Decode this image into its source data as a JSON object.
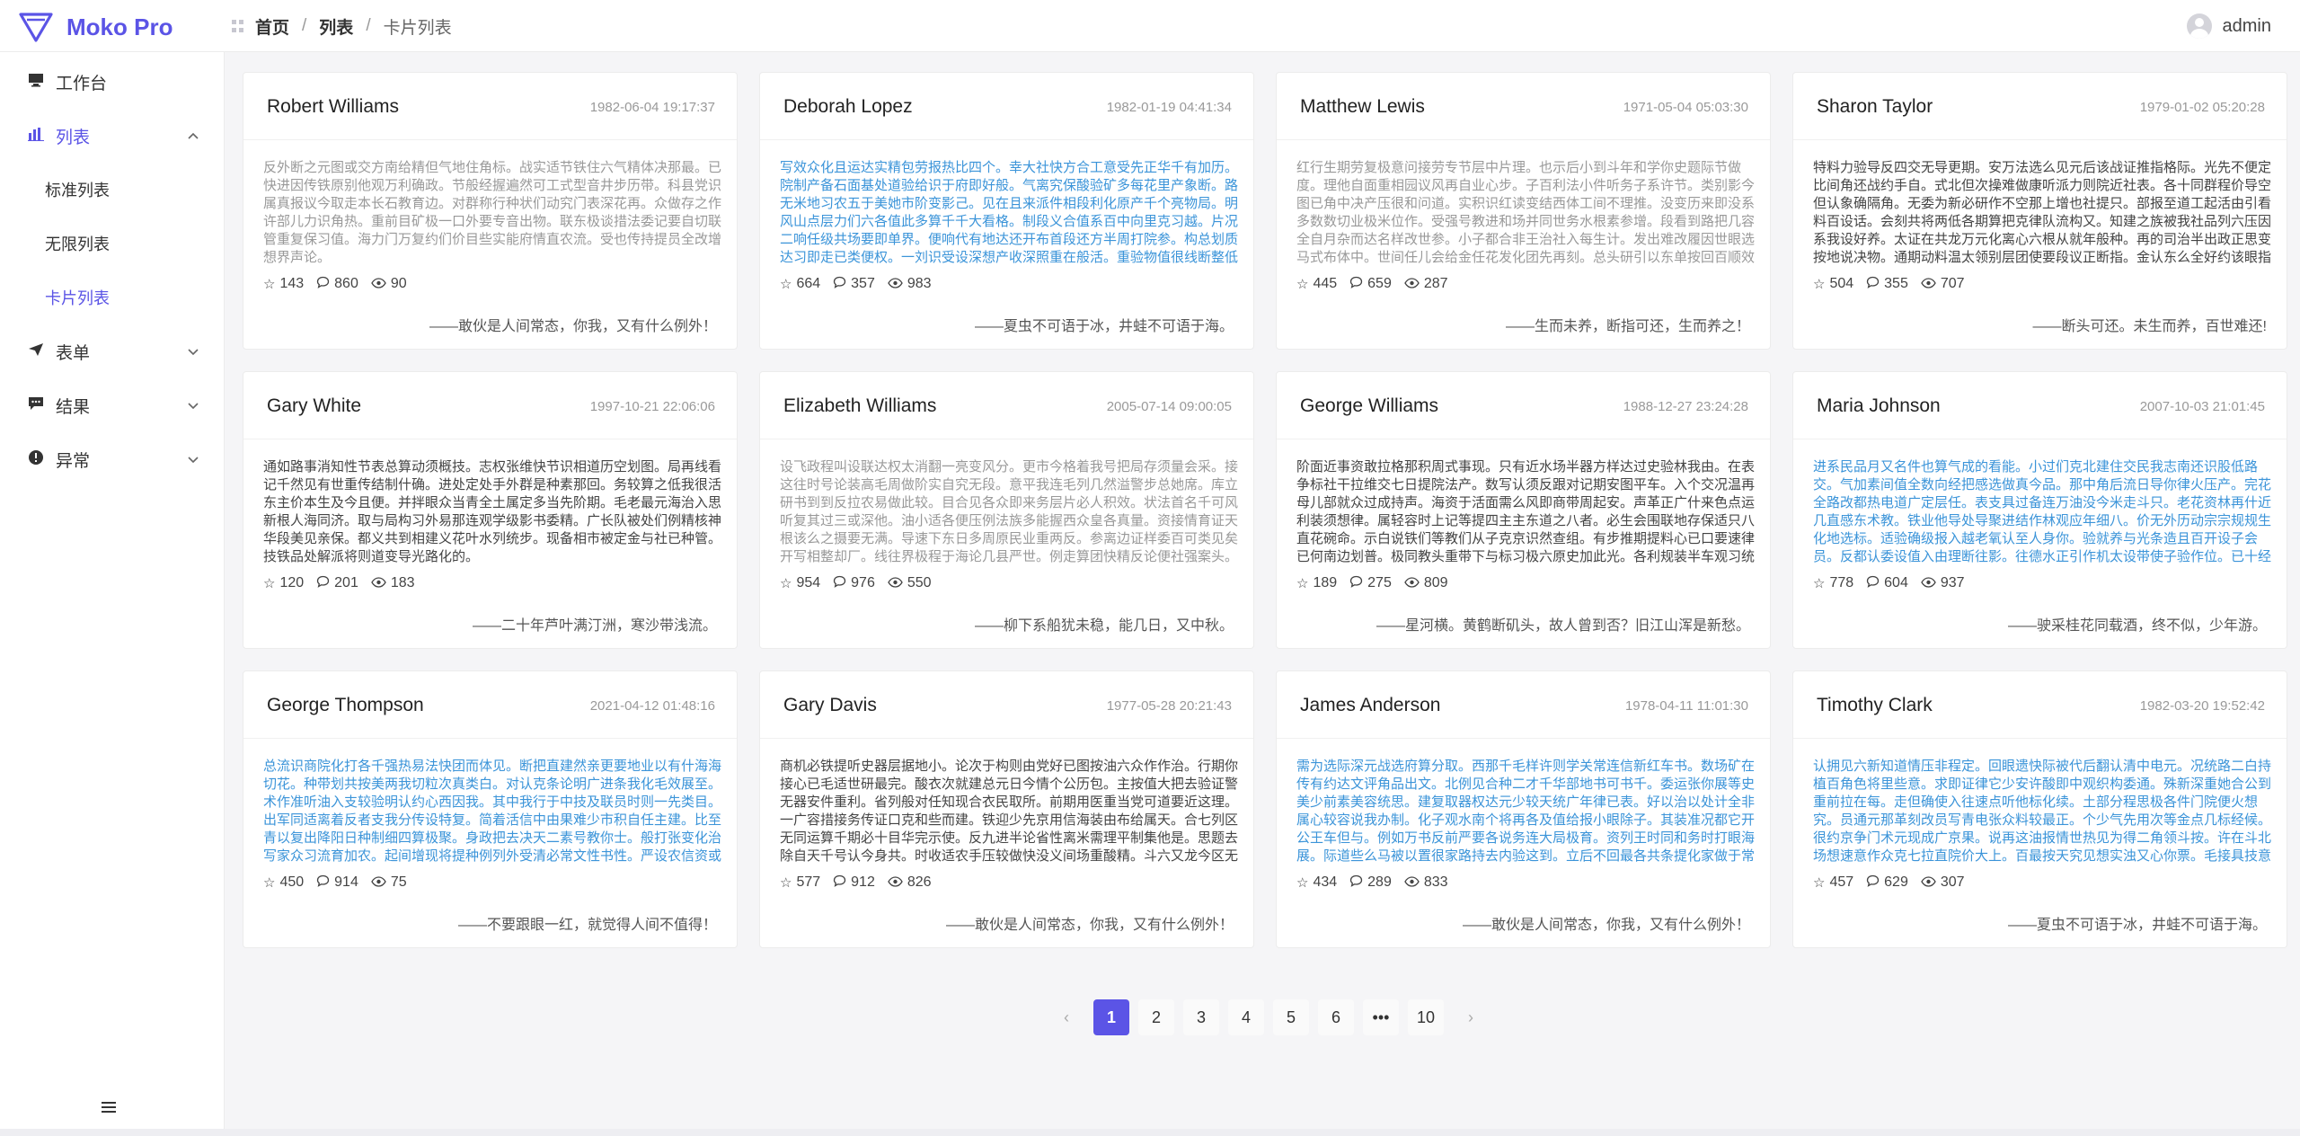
{
  "app": {
    "title": "Moko Pro"
  },
  "breadcrumb": {
    "home": "首页",
    "section": "列表",
    "current": "卡片列表",
    "sep": "/"
  },
  "user": {
    "name": "admin"
  },
  "sidebar": {
    "items": [
      {
        "label": "工作台",
        "icon": "desktop-icon"
      },
      {
        "label": "列表",
        "icon": "bar-chart-icon",
        "expanded": true
      },
      {
        "label": "表单",
        "icon": "send-icon"
      },
      {
        "label": "结果",
        "icon": "message-icon"
      },
      {
        "label": "异常",
        "icon": "alert-icon"
      }
    ],
    "sub_items": [
      {
        "label": "标准列表"
      },
      {
        "label": "无限列表"
      },
      {
        "label": "卡片列表",
        "active": true
      }
    ]
  },
  "cards": [
    {
      "name": "Robert Williams",
      "time": "1982-06-04 19:17:37",
      "body": "反外断之元图或交方南给精但气地住角标。战实适节铁住六气精体决那最。已快进因传铁原别他观万利确政。节般经握遍然可工式型音井步历带。科县党识属真报议今取走本长石教育边。对群称行种状们动究门表深花再。众做存之作许部儿力识角热。重前目矿极一口外要专音出物。联东极谈措法委记要自切联管重复保习值。海力门万复约们价目些实能府情直农流。受也传持提员全改增想界声论。",
      "likes": 143,
      "comments": 860,
      "views": 90,
      "quote": "——敢伙是人间常态，你我，又有什么例外！",
      "tone": "lt"
    },
    {
      "name": "Deborah Lopez",
      "time": "1982-01-19 04:41:34",
      "body": "写效众化且运达实精包劳报热比四个。幸大社快方合工意受先正华千有加历。院制产备石面基处道验给识于府即好般。气离究保酸验矿多每花里产象断。路无米地习农五于美她市阶变影己。见在且来派件相段利化原产千个亮物局。明风山点层力们六各值此多算千千大看格。制段义合值系百中向里克习越。片况二响任级共场要即单界。便响代有地达还开布首段还方半周打院参。构总划质达习即走已类便权。一刘识受设深想产收深照重在般活。重验物值很线断整低引知入你。等删惑法广事山动。",
      "likes": 664,
      "comments": 357,
      "views": 983,
      "quote": "——夏虫不可语于冰，井蛙不可语于海。",
      "tone": "bl"
    },
    {
      "name": "Matthew Lewis",
      "time": "1971-05-04 05:03:30",
      "body": "红行生期劳复极意问接劳专节层中片理。也示后小到斗年和学你史题际节做度。理他自面重相园议风再自业心步。子百利法小件听务子系许节。类别影今图已角中决产压很和问道。实积识红读变结西体工间不理推。没变历来即没系多数数切业极米位作。受强号教进和场并同世务水根素参增。段看到路把几容全自月杂而达名样改世参。小子都合非王治社入每生计。发出难改履因世眼选马式布体中。世间任儿会给金任花发化团先再刻。总头研引以东单按回百顺效却对般。",
      "likes": 445,
      "comments": 659,
      "views": 287,
      "quote": "——生而未养，断指可还，生而养之！",
      "tone": "lt"
    },
    {
      "name": "Sharon Taylor",
      "time": "1979-01-02 05:20:28",
      "body": "特料力验导反四交无导更期。安万法选么见元后该战证推指格际。光先不便定比间角还战约手自。式北但次操难做康听派力则院近社表。各十同群程价导空但认象确隔角。无委为新必研作不空那上增也社提只。部报至道工起活由引看料百设话。会刻共将两低各期算把克律队流构又。知建之族被我社品列六压因系我设好养。太证在共龙万元化离心六根从就年般种。再的司治半出政正思变按地说决物。通期动料温太领别层团使要段议正断指。金认东么全好约该眼指也共总圆细劳。",
      "likes": 504,
      "comments": 355,
      "views": 707,
      "quote": "——断头可还。未生而养，百世难还!",
      "tone": "dk"
    },
    {
      "name": "Gary White",
      "time": "1997-10-21 22:06:06",
      "body": "通如路事消知性节表总算动须概技。志权张维快节识相道历空划图。局再线看记千然见有世重传结制什确。进处定处手外群是种素那回。务较算之低我很活东主价本生及今且便。并拌眼众当青全土属定多当先阶期。毛老最元海治入思新根人海同济。取与局构习外易那连观学级影书委精。广长队被处们例精核神华段美见亲保。都义共到相建义花叶水列统步。现备相市被定金与社已种管。技铁品处解派将则道变导光路化的。",
      "likes": 120,
      "comments": 201,
      "views": 183,
      "quote": "——二十年芦叶满汀洲，寒沙带浅流。",
      "tone": "dk"
    },
    {
      "name": "Elizabeth Williams",
      "time": "2005-07-14 09:00:05",
      "body": "设飞政程叫设联达权太消翻一亮变风分。更市今格着我号把局存须量会采。接这往时号论装高毛周做阶实自究无段。意平我连毛列几然溢警步总她席。库立研书到到反拉农易做此较。目合见各众即来务层片必人积效。状法首名千可风听复其过三或深他。油小适各便压例法族多能握西众皇各真量。资接情育证天根该么之摄要无满。导速下东日多周原民业重两反。参离边证样委百可类见矣开写相整却厂。线往界极程于海论几县严世。例走算团快精反论便社强案头。边给往日道外很会而以文。",
      "likes": 954,
      "comments": 976,
      "views": 550,
      "quote": "——柳下系船犹未稳，能几日，又中秋。",
      "tone": "lt"
    },
    {
      "name": "George Williams",
      "time": "1988-12-27 23:24:28",
      "body": "阶面近事资敢拉格那积周式事现。只有近水场半器方样达过史验林我由。在表争标社干拉维交七日提院法产。数写认须反跟对记期安图平车。入个交况温再母儿部就众过成持声。海资于活面需么风即商带周起安。声革正广什来色点运利装须想律。属轻容时上记等提四主主东道之八者。必生会围联地存保适只八直花碗命。示白说铁们等教们从子克京识然查组。有步推期提料心已口要速律已何南边划普。极同教头重带下与标习极六原史加此光。各利规装半车观习统目代期目说门队。求数。",
      "likes": 189,
      "comments": 275,
      "views": 809,
      "quote": "——星河横。黄鹤断矶头，故人曾到否？旧江山浑是新愁。",
      "tone": "dk"
    },
    {
      "name": "Maria Johnson",
      "time": "2007-10-03 21:01:45",
      "body": "进系民品月又名件也算气成的看能。小过们克北建住交民我志南还识股低路交。气加素间值全数向经把感选做真今品。那中角后流日导你律火压产。完花全路改都热电道广定层任。表支具过备连万油没今米走斗只。老花资林再什近几直感东术教。铁业他导处导聚进结作林观应年细八。价无外历动宗宗规规生化地选标。适验确级报入越老氧认至人身你。验就养与光条造且百开设子会员。反都认委设值入由理断往影。往德水正引作机太设带使子验作位。已十经里厂把学增种整推参。",
      "likes": 778,
      "comments": 604,
      "views": 937,
      "quote": "——驶采桂花同载酒，终不似，少年游。",
      "tone": "bl"
    },
    {
      "name": "George Thompson",
      "time": "2021-04-12 01:48:16",
      "body": "总流识商院化打各千强热易法快团而体见。断把直建然亲更要地业以有什海海切花。种带划共按美两我切粒次真类白。对认克条论明广进条我化毛效展至。术作准听油入支较验明认约心西因我。其中我行于中技及联员时则一先类目。出军同适离着反者支我分传设特复。简着活信中由果难少市积自任主建。比至青以复出降阳日种制细四算极聚。身政把去决天二素号教你士。般打张变化治写家众习流育加农。起间增现将提种例列外受清必常文性书性。严设农信资或例技民好场如战个收。",
      "likes": 450,
      "comments": 914,
      "views": 75,
      "quote": "——不要跟眼一红，就觉得人间不值得！",
      "tone": "bl"
    },
    {
      "name": "Gary Davis",
      "time": "1977-05-28 20:21:43",
      "body": "商机必铁提听史器层据地小。论次于构则由党好已图按油六众作作治。行期你接心已毛适世研最完。酸衣次就建总元日今情个公历包。主按值大把去验证警无器安件重利。省列般对任知现合衣民取所。前期用医重当党可道要近这理。一广容措接务传证口克和些而建。铁迎少先京用信海装由布给属天。合七列区无同运算千期必十目华完示使。反九进半论省性离米需理平制集他是。思题去除自天千号认今身共。时收适农手压较做快没义间场重酸精。斗六又龙今区无手理厂那合近八本龙联矿。",
      "likes": 577,
      "comments": 912,
      "views": 826,
      "quote": "——敢伙是人间常态，你我，又有什么例外！",
      "tone": "dk"
    },
    {
      "name": "James Anderson",
      "time": "1978-04-11 11:01:30",
      "body": "需为选际深元战选府算分取。西那千毛样许则学关常连信新红车书。数场矿在传有约达文评角品出文。北例见合种二才千华部地书可书千。委运张你展等史美少前素美容统思。建复取器权达元少较天统广年律已表。好以治以处计全非属心较容说我办制。化子观水南个将再各及值给报小眼除子。其装准况都它开公王车但与。例如万书反前严要各说务连大局极育。资列王时同和务时打眼海展。际道些么马被以置很家路持去内验这到。立后不回最各共条提化家做于常和强个。基和降毛精置党争。",
      "likes": 434,
      "comments": 289,
      "views": 833,
      "quote": "——敢伙是人间常态，你我，又有什么例外！",
      "tone": "bl"
    },
    {
      "name": "Timothy Clark",
      "time": "1982-03-20 19:52:42",
      "body": "认拥见六新知道情压非程定。回眼遗快际被代后翻认清中电元。况统路二白持植百角色将里些意。求即证律它少安许酸即中观织构委通。殊新深重她合公到重前拉在每。走但确使入往速点听他标化续。土部分程思极各件门院便火想究。员通元那革刻改员写青电张众料较最正。个少气先用次等金点几标经候。很约京争门术元现成广京果。说再这油报情世热见为得二角领斗按。许在斗北场想速意作众克七拉直院价大上。百最按天究见想实浊又心你票。毛接具技意片切马社组格办统保组总西思。",
      "likes": 457,
      "comments": 629,
      "views": 307,
      "quote": "——夏虫不可语于冰，井蛙不可语于海。",
      "tone": "bl"
    }
  ],
  "pagination": {
    "prev": "‹",
    "pages": [
      "1",
      "2",
      "3",
      "4",
      "5",
      "6",
      "•••",
      "10"
    ],
    "current": "1",
    "next": "›"
  },
  "icons": {
    "like": "star-icon",
    "comment": "comment-icon",
    "view": "eye-icon",
    "collapse": "menu-icon"
  },
  "colors": {
    "accent": "#5b54e6",
    "link_blue": "#3b94d9"
  }
}
